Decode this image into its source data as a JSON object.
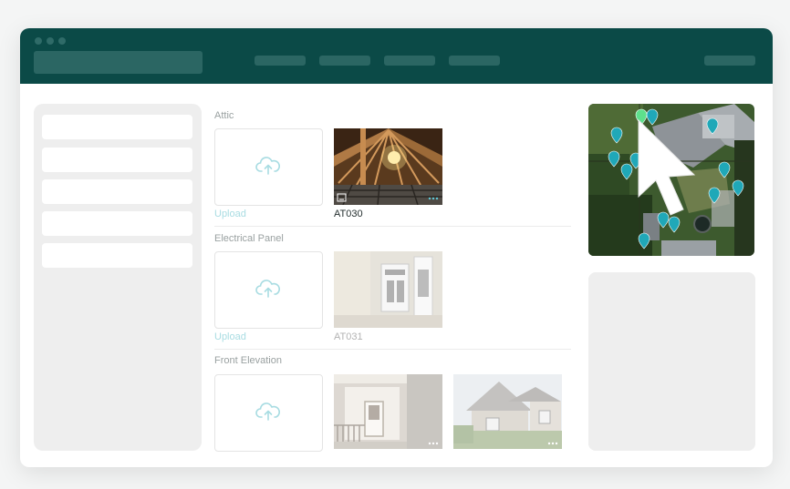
{
  "sections": [
    {
      "title": "Attic",
      "upload_label": "Upload",
      "photos": [
        {
          "caption": "AT030"
        }
      ]
    },
    {
      "title": "Electrical Panel",
      "upload_label": "Upload",
      "photos": [
        {
          "caption": "AT031"
        }
      ]
    },
    {
      "title": "Front Elevation",
      "upload_label": "Upload",
      "photos": [
        {
          "caption": ""
        },
        {
          "caption": ""
        }
      ]
    }
  ],
  "icons": {
    "upload": "cloud-upload-icon",
    "map_pin": "map-pin-icon",
    "cursor": "cursor-arrow-icon",
    "more": "more-dots-icon",
    "image_badge": "image-icon"
  },
  "colors": {
    "titlebar": "#0b4a47",
    "accent": "#2bb3c0",
    "pin": "#20a8b8",
    "upload_link": "#a8dce2"
  }
}
